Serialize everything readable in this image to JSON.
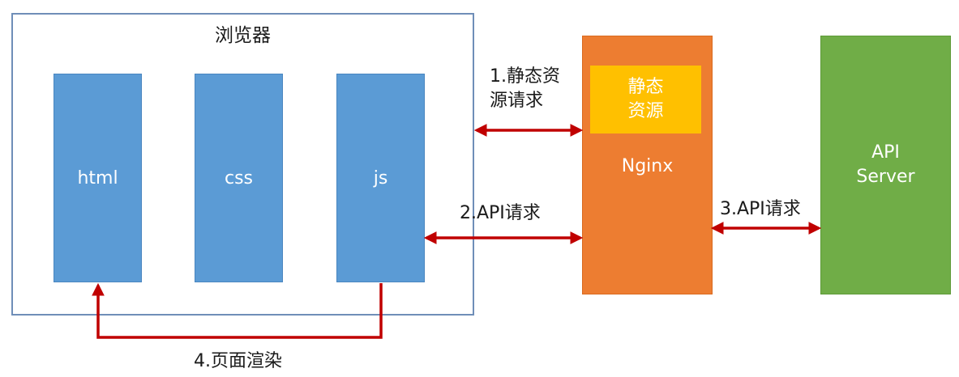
{
  "browser": {
    "title": "浏览器",
    "columns": [
      "html",
      "css",
      "js"
    ]
  },
  "nginx": {
    "label": "Nginx",
    "static_resources": "静态\n资源"
  },
  "api_server": {
    "label": "API\nServer"
  },
  "edges": {
    "static_request": "1.静态资\n源请求",
    "browser_api_request": "2.API请求",
    "nginx_api_request": "3.API请求",
    "page_render": "4.页面渲染"
  },
  "colors": {
    "browser_border": "#6f8eb8",
    "column_fill": "#5b9bd5",
    "nginx_fill": "#ed7d31",
    "static_fill": "#ffc000",
    "api_fill": "#70ad47",
    "arrow": "#c00000"
  }
}
